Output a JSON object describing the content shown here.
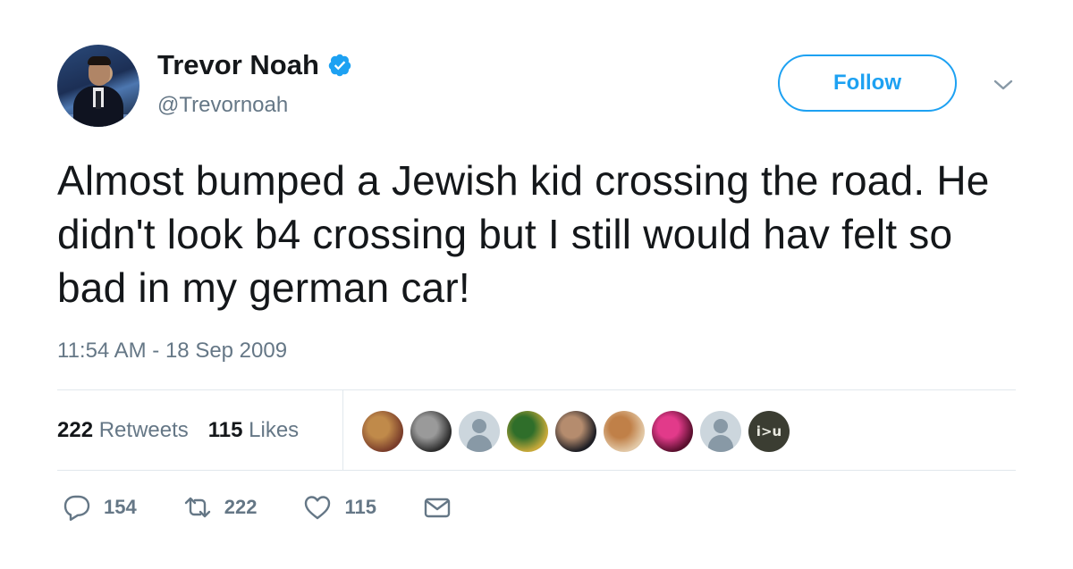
{
  "author": {
    "name": "Trevor Noah",
    "handle": "@Trevornoah",
    "verified": true
  },
  "follow_label": "Follow",
  "tweet": {
    "text": "Almost bumped a Jewish kid crossing the road. He didn't look b4 crossing but I still would hav felt so bad in my german car!",
    "timestamp": "11:54 AM - 18 Sep 2009"
  },
  "stats": {
    "retweets_count": "222",
    "retweets_label": "Retweets",
    "likes_count": "115",
    "likes_label": "Likes"
  },
  "likers": [
    {
      "kind": "photo",
      "colors": [
        "#7a3d2a",
        "#c08a4a"
      ]
    },
    {
      "kind": "photo",
      "colors": [
        "#2c2c2c",
        "#9a9a9a"
      ]
    },
    {
      "kind": "default"
    },
    {
      "kind": "photo",
      "colors": [
        "#c7a93a",
        "#2f6e2a"
      ]
    },
    {
      "kind": "photo",
      "colors": [
        "#1e1e24",
        "#b58c6e"
      ]
    },
    {
      "kind": "photo",
      "colors": [
        "#e2c8a6",
        "#c08048"
      ]
    },
    {
      "kind": "photo",
      "colors": [
        "#5a0f2e",
        "#e23a8a"
      ]
    },
    {
      "kind": "default"
    },
    {
      "kind": "text",
      "text": "i>u"
    }
  ],
  "actions": {
    "replies": "154",
    "retweets": "222",
    "likes": "115"
  },
  "colors": {
    "accent": "#1da1f2",
    "secondary_text": "#657786",
    "divider": "#e1e8ed"
  }
}
